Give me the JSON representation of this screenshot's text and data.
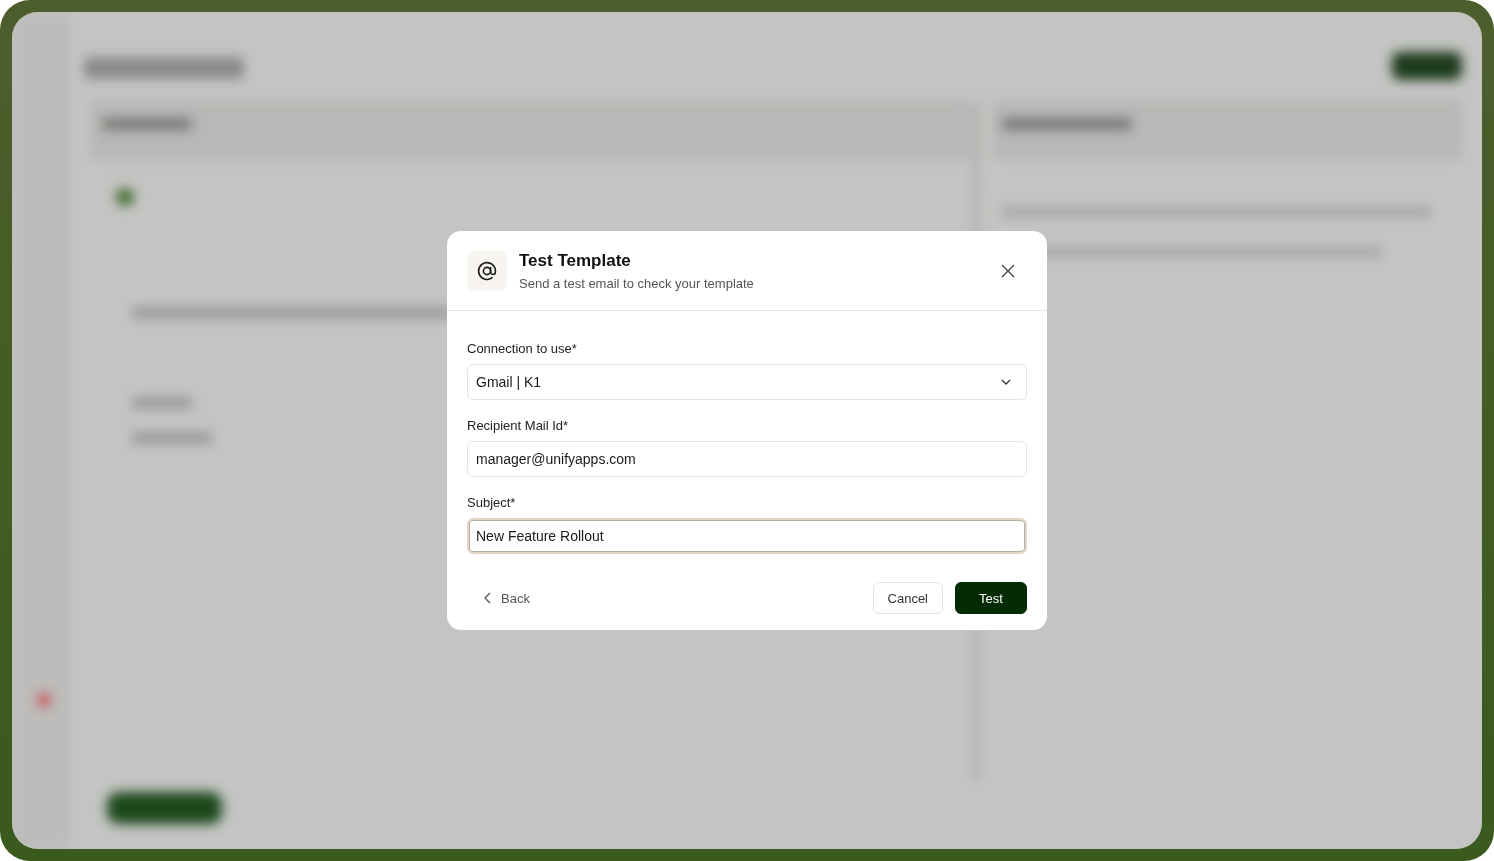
{
  "dialog": {
    "title": "Test Template",
    "subtitle": "Send a test email to check your template"
  },
  "fields": [
    {
      "kind": "select",
      "label": "Connection to use*",
      "value": "Gmail | K1",
      "focused": false
    },
    {
      "kind": "text",
      "label": "Recipient Mail Id*",
      "value": "manager@unifyapps.com",
      "focused": false
    },
    {
      "kind": "text",
      "label": "Subject*",
      "value": "New Feature Rollout",
      "focused": true
    }
  ],
  "back": "Back",
  "buttons": [
    {
      "label": "Cancel",
      "primary": false
    },
    {
      "label": "Test",
      "primary": true
    }
  ]
}
